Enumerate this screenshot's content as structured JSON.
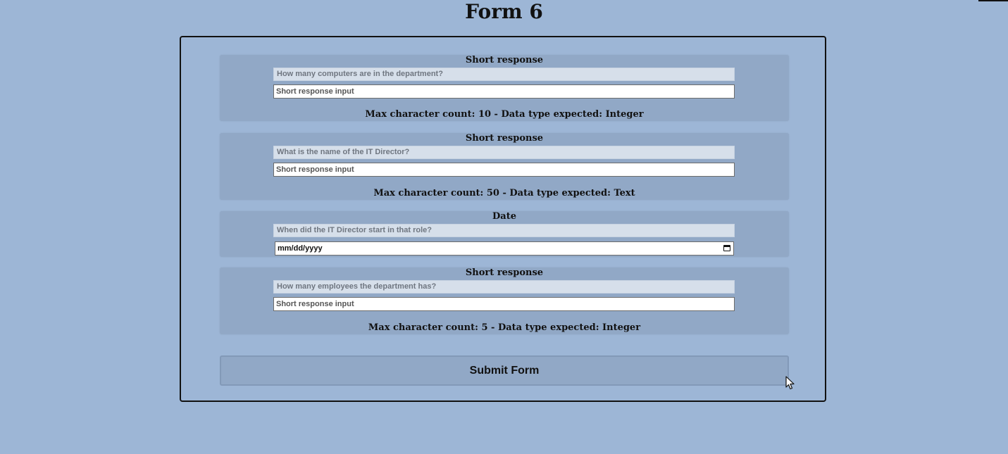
{
  "page": {
    "title": "Form 6"
  },
  "questions": [
    {
      "type": "Short response",
      "prompt": "How many computers are in the department?",
      "input_placeholder": "Short response input",
      "constraint": "Max character count: 10 - Data type expected: Integer"
    },
    {
      "type": "Short response",
      "prompt": "What is the name of the IT Director?",
      "input_placeholder": "Short response input",
      "constraint": "Max character count: 50 - Data type expected: Text"
    },
    {
      "type": "Date",
      "prompt": "When did the IT Director start in that role?",
      "date_placeholder": "mm/dd/yyyy"
    },
    {
      "type": "Short response",
      "prompt": "How many employees the department has?",
      "input_placeholder": "Short response input",
      "constraint": "Max character count: 5 - Data type expected: Integer"
    }
  ],
  "submit": {
    "label": "Submit Form"
  },
  "icons": {
    "calendar": "calendar-icon",
    "cursor": "mouse-pointer-icon"
  },
  "colors": {
    "background": "#9db6d6",
    "card": "#91a8c6",
    "prompt_bg": "#d6dfea",
    "border": "#111111"
  }
}
